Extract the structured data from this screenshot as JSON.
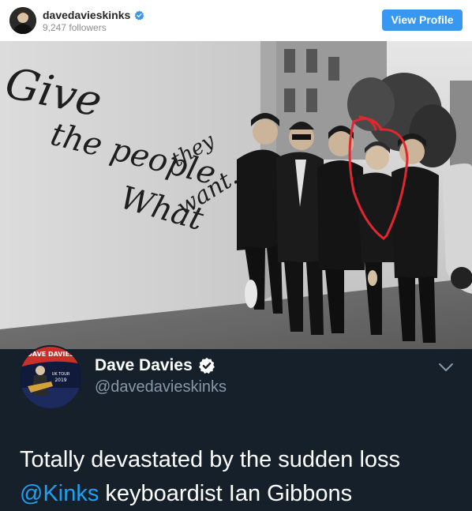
{
  "instagram": {
    "username": "davedavieskinks",
    "followers": "9,247 followers",
    "view_profile_label": "View Profile",
    "verified_icon": "verified-badge-icon",
    "button_color": "#3897f0"
  },
  "photo": {
    "graffiti": {
      "line1": "Give",
      "line2": "the people",
      "line3": "What",
      "line4": "they",
      "line5": "want."
    },
    "annotation_color": "#e0262f"
  },
  "tweet": {
    "name": "Dave Davies",
    "handle": "@davedavieskinks",
    "text_line1": "Totally devastated by the sudden loss",
    "mention": "@Kinks",
    "text_line2_rest": " keyboardist Ian Gibbons",
    "avatar_text": {
      "top": "DAVE DAVIES",
      "tour": "UK TOUR",
      "year": "2019"
    },
    "background_color": "#15202b",
    "mention_color": "#1da1f2"
  }
}
